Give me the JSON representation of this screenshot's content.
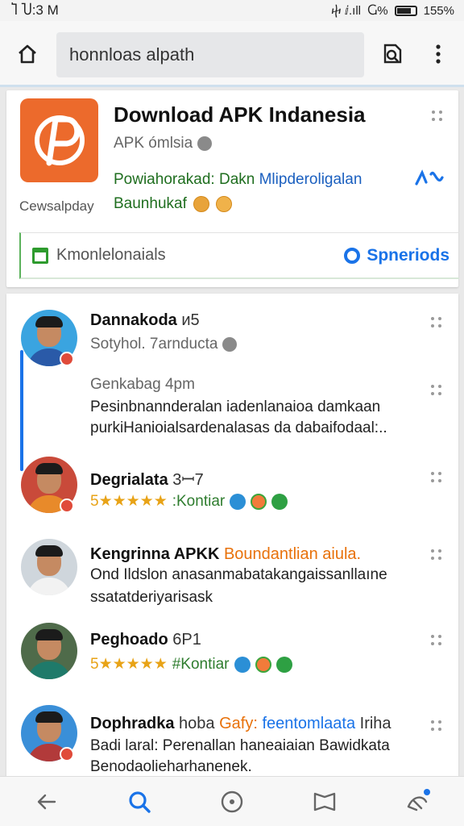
{
  "status": {
    "time": "Ⴈ Ⴎ:3 M",
    "network": "ⴕ ⅈ.ıll",
    "battery_pct": "Ⴚ%",
    "battery_text": "155%"
  },
  "toolbar": {
    "url": "honnloas alpath"
  },
  "app": {
    "title": "Download APK Indanesia",
    "subtitle": "APK ómlsia",
    "desc_green": "Powiahorakad: Dakn ",
    "desc_blue": "Mlipderoligalan",
    "desc2": "Baunhukaf",
    "developer": "Cewsalpday"
  },
  "actions": {
    "left_label": "Kmonlelonaials",
    "right_label": "Spneriods"
  },
  "comments": [
    {
      "name": "Dannakoda",
      "name_suffix": "ᴎ5",
      "meta": "Sotyhol. 7arnducta",
      "time": "Genkabag 4pm",
      "line1": "Pesinbnannderalan iadenlanaioa damkaan",
      "line2": "purkiHanioialsardenalasas da dabaifodaal:.."
    },
    {
      "name": "Degrialata",
      "name_suffix": "3ꟷ7",
      "stars": "5★★★★★",
      "stars_text": ":Kontiar"
    },
    {
      "name": "Kengrinna APKK",
      "orange": "Boundantlian aiula.",
      "line1": "Ond Ildslon anasanmabatakangaissanllaıne",
      "line2": "ssatatderiyarisask"
    },
    {
      "name": "Peghoado",
      "name_suffix": "6P1",
      "stars": "5★★★★★",
      "stars_text": "#Kontiar"
    },
    {
      "name": "Dophradka",
      "light": " hoba ",
      "orange": "Gafy: ",
      "teal": "feentomlaata",
      "light2": " Iriha",
      "line1": "Badi laral: Perenallan haneaiaian Bawidkata",
      "line2": "Benodaolieharhanenek."
    }
  ],
  "colors": {
    "accent": "#1a73e8",
    "app_icon": "#ec6a2c",
    "green_text": "#1f6e1f"
  }
}
